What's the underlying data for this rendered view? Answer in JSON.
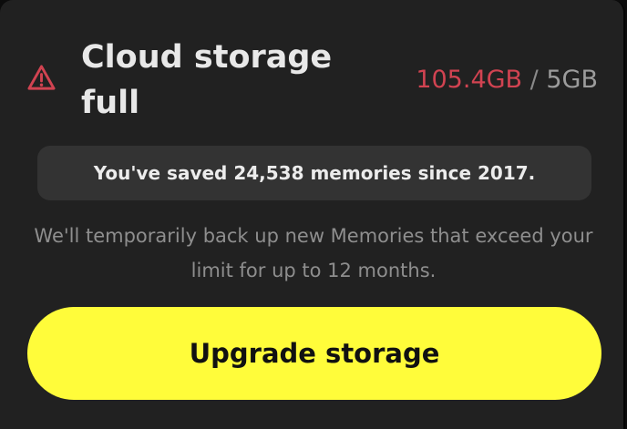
{
  "header": {
    "warning_icon": "warning-triangle-icon",
    "title": "Cloud storage full",
    "usage": {
      "used": "105.4GB",
      "separator": "/",
      "limit": "5GB"
    }
  },
  "summary": {
    "memories_text": "You've saved 24,538 memories since 2017."
  },
  "info": {
    "text": "We'll temporarily back up new Memories that exceed your limit for up to 12 months."
  },
  "actions": {
    "upgrade_label": "Upgrade storage"
  },
  "colors": {
    "background": "#212121",
    "accent_yellow": "#fffc3a",
    "warning_red": "#d14351",
    "text_primary": "#e8e8e8",
    "text_secondary": "#8e8e8e",
    "pill_background": "#333333"
  }
}
